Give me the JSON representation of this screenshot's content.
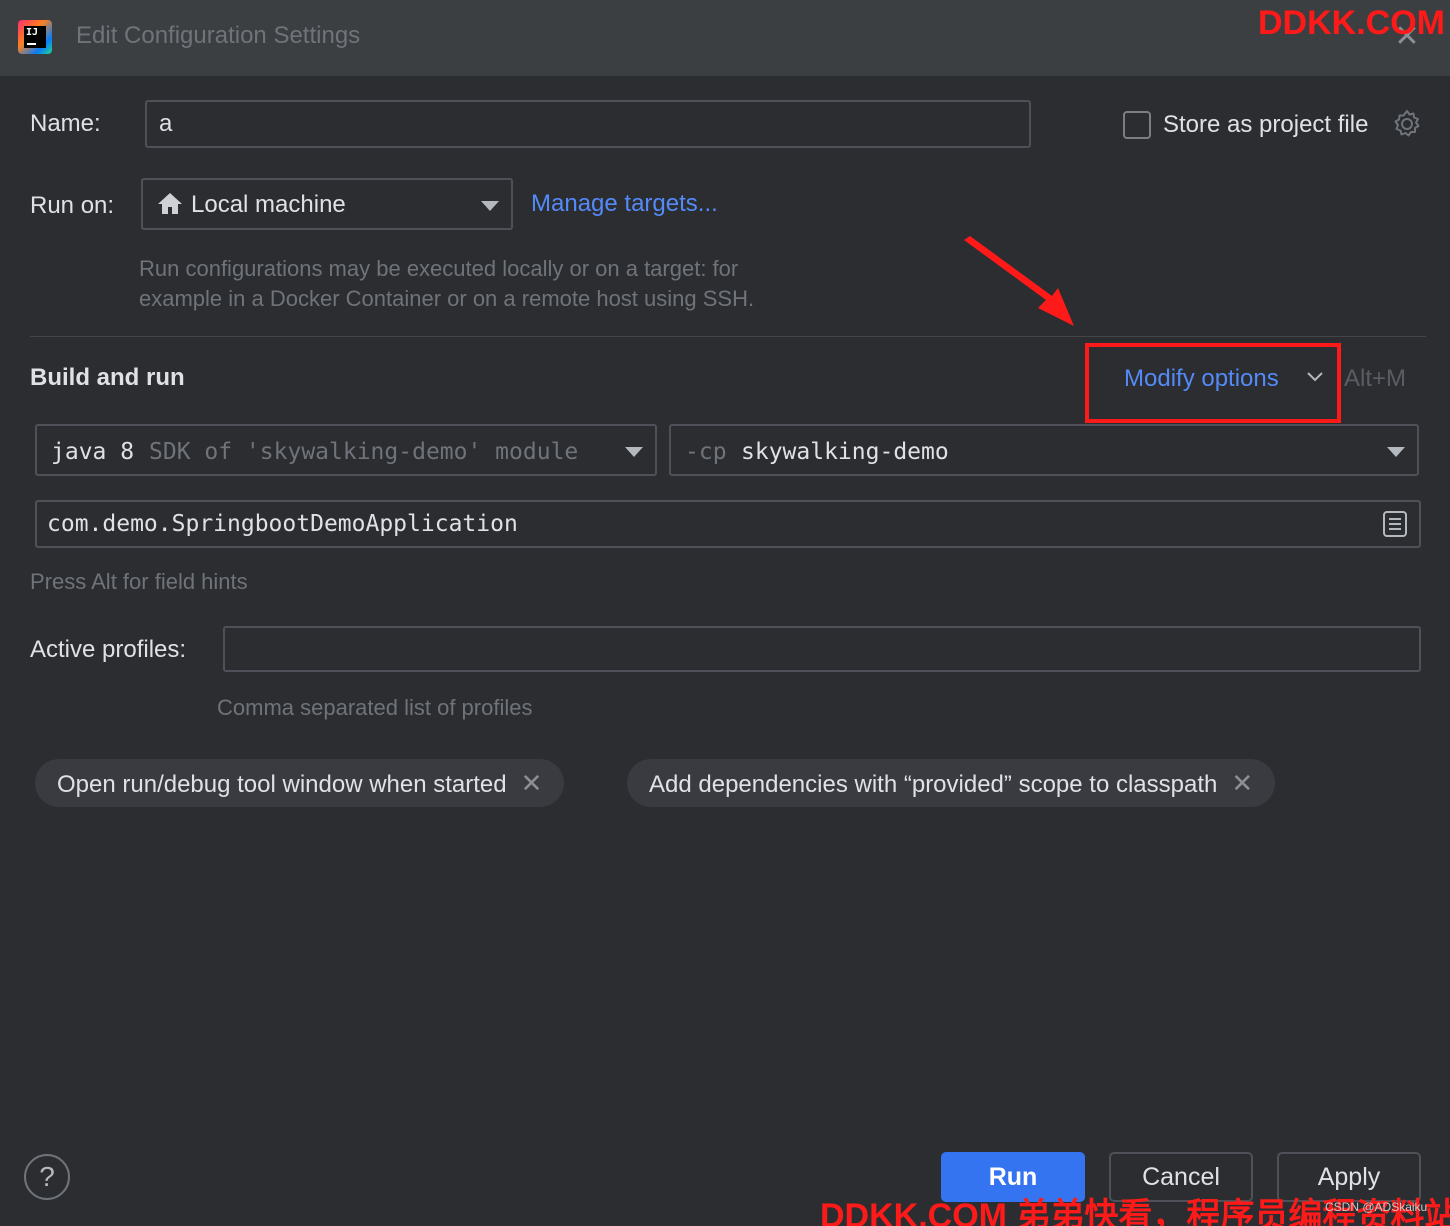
{
  "window": {
    "title": "Edit Configuration Settings",
    "app_icon": "intellij-idea-icon",
    "close_icon": "close-icon"
  },
  "watermark": {
    "top": "DDKK.COM",
    "bottom": "DDKK.COM 弟弟快看，程序员编程资料站",
    "small": "CSDN @ADSkaiku"
  },
  "name_field": {
    "label": "Name:",
    "value": "a"
  },
  "store_project": {
    "label": "Store as project file",
    "checked": false,
    "icon": "gear-icon"
  },
  "run_on": {
    "label": "Run on:",
    "value": "Local machine",
    "icon": "home-icon",
    "manage_link": "Manage targets...",
    "hint_line1": "Run configurations may be executed locally or on a target: for",
    "hint_line2": "example in a Docker Container or on a remote host using SSH."
  },
  "build_and_run": {
    "title": "Build and run",
    "modify_options": "Modify options",
    "modify_shortcut": "Alt+M",
    "jdk": {
      "main": "java 8",
      "sub": "SDK of 'skywalking-demo' module"
    },
    "classpath": {
      "prefix": "-cp",
      "value": "skywalking-demo"
    },
    "main_class": "com.demo.SpringbootDemoApplication",
    "field_hint": "Press Alt for field hints"
  },
  "active_profiles": {
    "label": "Active profiles:",
    "value": "",
    "hint": "Comma separated list of profiles"
  },
  "chips": [
    {
      "label": "Open run/debug tool window when started"
    },
    {
      "label": "Add dependencies with “provided” scope to classpath"
    }
  ],
  "buttons": {
    "help": "?",
    "run": "Run",
    "cancel": "Cancel",
    "apply": "Apply"
  },
  "colors": {
    "background": "#2b2d30",
    "link": "#548af7",
    "primary_button": "#3574f0",
    "annotation_red": "#ff1a1a"
  }
}
